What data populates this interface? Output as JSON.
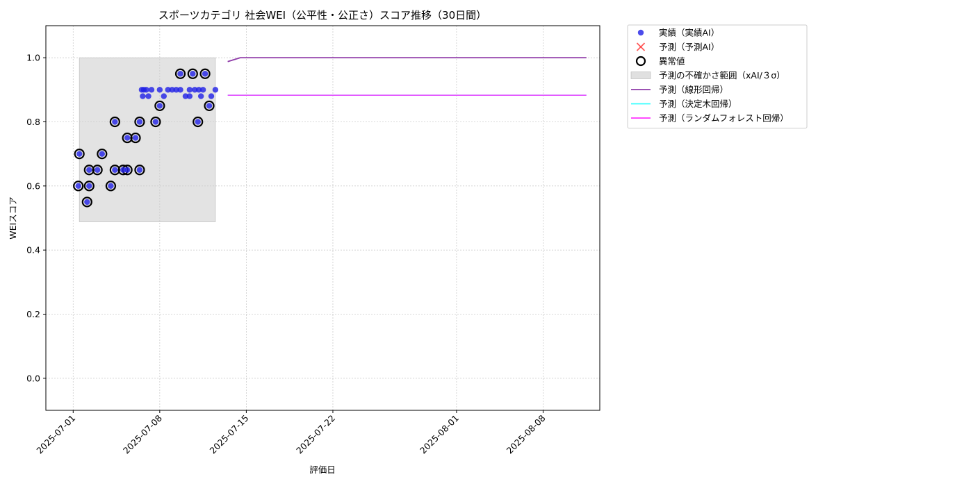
{
  "chart_data": {
    "type": "scatter",
    "title": "スポーツカテゴリ 社会WEI（公平性・公正さ）スコア推移（30日間）",
    "xlabel": "評価日",
    "ylabel": "WEIスコア",
    "xlim": [
      "2025-06-28T19:00",
      "2025-08-12T14:00"
    ],
    "ylim": [
      -0.1,
      1.1
    ],
    "x_ticks": [
      "2025-07-01",
      "2025-07-08",
      "2025-07-15",
      "2025-07-22",
      "2025-08-01",
      "2025-08-08"
    ],
    "y_ticks": [
      0.0,
      0.2,
      0.4,
      0.6,
      0.8,
      1.0
    ],
    "y_tick_labels": [
      "0.0",
      "0.2",
      "0.4",
      "0.6",
      "0.8",
      "1.0"
    ],
    "grid": true,
    "legend_position": "outside-top-right",
    "colors": {
      "actual": "#1f1fe6",
      "predicted": "#ff3030",
      "anomaly_edge": "#000000",
      "uncertainty": "#cccccc",
      "linear": "#8e3aa8",
      "tree": "#33ffff",
      "forest": "#ff33ff",
      "grid": "#cccccc"
    },
    "legend": [
      {
        "label": "実績（実績AI）",
        "kind": "dot",
        "color": "#1f1fe6"
      },
      {
        "label": "予測（予測AI）",
        "kind": "cross",
        "color": "#ff3030"
      },
      {
        "label": "異常値",
        "kind": "ring",
        "color": "#000000"
      },
      {
        "label": "予測の不確かさ範囲（xAI/３σ）",
        "kind": "patch",
        "color": "#cccccc"
      },
      {
        "label": "予測（線形回帰）",
        "kind": "line",
        "color": "#8e3aa8"
      },
      {
        "label": "予測（決定木回帰）",
        "kind": "line",
        "color": "#33ffff"
      },
      {
        "label": "予測（ランダムフォレスト回帰）",
        "kind": "line",
        "color": "#ff33ff"
      }
    ],
    "uncertainty_band": {
      "x": [
        "2025-07-01T12:00",
        "2025-07-12T12:00"
      ],
      "y": [
        0.488,
        1.0
      ]
    },
    "actual": [
      {
        "x": "2025-07-01T10:00",
        "y": 0.6,
        "anomaly": true
      },
      {
        "x": "2025-07-01T12:00",
        "y": 0.7,
        "anomaly": true
      },
      {
        "x": "2025-07-02T03:00",
        "y": 0.55,
        "anomaly": true
      },
      {
        "x": "2025-07-02T07:00",
        "y": 0.6,
        "anomaly": true
      },
      {
        "x": "2025-07-02T07:00",
        "y": 0.65,
        "anomaly": true
      },
      {
        "x": "2025-07-02T23:00",
        "y": 0.65,
        "anomaly": true
      },
      {
        "x": "2025-07-03T08:00",
        "y": 0.7,
        "anomaly": true
      },
      {
        "x": "2025-07-04T01:00",
        "y": 0.6,
        "anomaly": true
      },
      {
        "x": "2025-07-04T09:00",
        "y": 0.8,
        "anomaly": true
      },
      {
        "x": "2025-07-04T09:00",
        "y": 0.65,
        "anomaly": true
      },
      {
        "x": "2025-07-05T01:00",
        "y": 0.65,
        "anomaly": true
      },
      {
        "x": "2025-07-05T09:00",
        "y": 0.65,
        "anomaly": true
      },
      {
        "x": "2025-07-05T09:00",
        "y": 0.75,
        "anomaly": true
      },
      {
        "x": "2025-07-06T01:00",
        "y": 0.75,
        "anomaly": true
      },
      {
        "x": "2025-07-06T09:00",
        "y": 0.65,
        "anomaly": true
      },
      {
        "x": "2025-07-06T09:00",
        "y": 0.8,
        "anomaly": true
      },
      {
        "x": "2025-07-06T13:00",
        "y": 0.9,
        "anomaly": false
      },
      {
        "x": "2025-07-06T15:00",
        "y": 0.88,
        "anomaly": false
      },
      {
        "x": "2025-07-06T17:00",
        "y": 0.9,
        "anomaly": false
      },
      {
        "x": "2025-07-06T22:00",
        "y": 0.9,
        "anomaly": false
      },
      {
        "x": "2025-07-07T02:00",
        "y": 0.88,
        "anomaly": false
      },
      {
        "x": "2025-07-07T08:00",
        "y": 0.9,
        "anomaly": false
      },
      {
        "x": "2025-07-07T16:00",
        "y": 0.8,
        "anomaly": true
      },
      {
        "x": "2025-07-08T00:00",
        "y": 0.85,
        "anomaly": true
      },
      {
        "x": "2025-07-08T00:00",
        "y": 0.9,
        "anomaly": false
      },
      {
        "x": "2025-07-08T08:00",
        "y": 0.88,
        "anomaly": false
      },
      {
        "x": "2025-07-08T16:00",
        "y": 0.9,
        "anomaly": false
      },
      {
        "x": "2025-07-09T00:00",
        "y": 0.9,
        "anomaly": false
      },
      {
        "x": "2025-07-09T08:00",
        "y": 0.9,
        "anomaly": false
      },
      {
        "x": "2025-07-09T16:00",
        "y": 0.95,
        "anomaly": true
      },
      {
        "x": "2025-07-09T16:00",
        "y": 0.9,
        "anomaly": false
      },
      {
        "x": "2025-07-10T02:00",
        "y": 0.88,
        "anomaly": false
      },
      {
        "x": "2025-07-10T10:00",
        "y": 0.88,
        "anomaly": false
      },
      {
        "x": "2025-07-10T10:00",
        "y": 0.9,
        "anomaly": false
      },
      {
        "x": "2025-07-10T16:00",
        "y": 0.95,
        "anomaly": true
      },
      {
        "x": "2025-07-10T20:00",
        "y": 0.9,
        "anomaly": false
      },
      {
        "x": "2025-07-11T02:00",
        "y": 0.8,
        "anomaly": true
      },
      {
        "x": "2025-07-11T04:00",
        "y": 0.9,
        "anomaly": false
      },
      {
        "x": "2025-07-11T08:00",
        "y": 0.88,
        "anomaly": false
      },
      {
        "x": "2025-07-11T12:00",
        "y": 0.9,
        "anomaly": false
      },
      {
        "x": "2025-07-11T16:00",
        "y": 0.95,
        "anomaly": true
      },
      {
        "x": "2025-07-12T00:00",
        "y": 0.85,
        "anomaly": true
      },
      {
        "x": "2025-07-12T04:00",
        "y": 0.88,
        "anomaly": false
      },
      {
        "x": "2025-07-12T12:00",
        "y": 0.9,
        "anomaly": false
      }
    ],
    "series": [
      {
        "name": "予測（線形回帰）",
        "color": "#8e3aa8",
        "points": [
          {
            "x": "2025-07-13T12:00",
            "y": 0.988
          },
          {
            "x": "2025-07-14T12:00",
            "y": 1.0
          },
          {
            "x": "2025-08-11T12:00",
            "y": 1.0
          }
        ]
      },
      {
        "name": "予測（決定木回帰）",
        "color": "#33ffff",
        "points": [
          {
            "x": "2025-07-13T12:00",
            "y": 0.883
          },
          {
            "x": "2025-08-11T12:00",
            "y": 0.883
          }
        ]
      },
      {
        "name": "予測（ランダムフォレスト回帰）",
        "color": "#ff33ff",
        "points": [
          {
            "x": "2025-07-13T12:00",
            "y": 0.883
          },
          {
            "x": "2025-08-11T12:00",
            "y": 0.883
          }
        ]
      }
    ]
  }
}
